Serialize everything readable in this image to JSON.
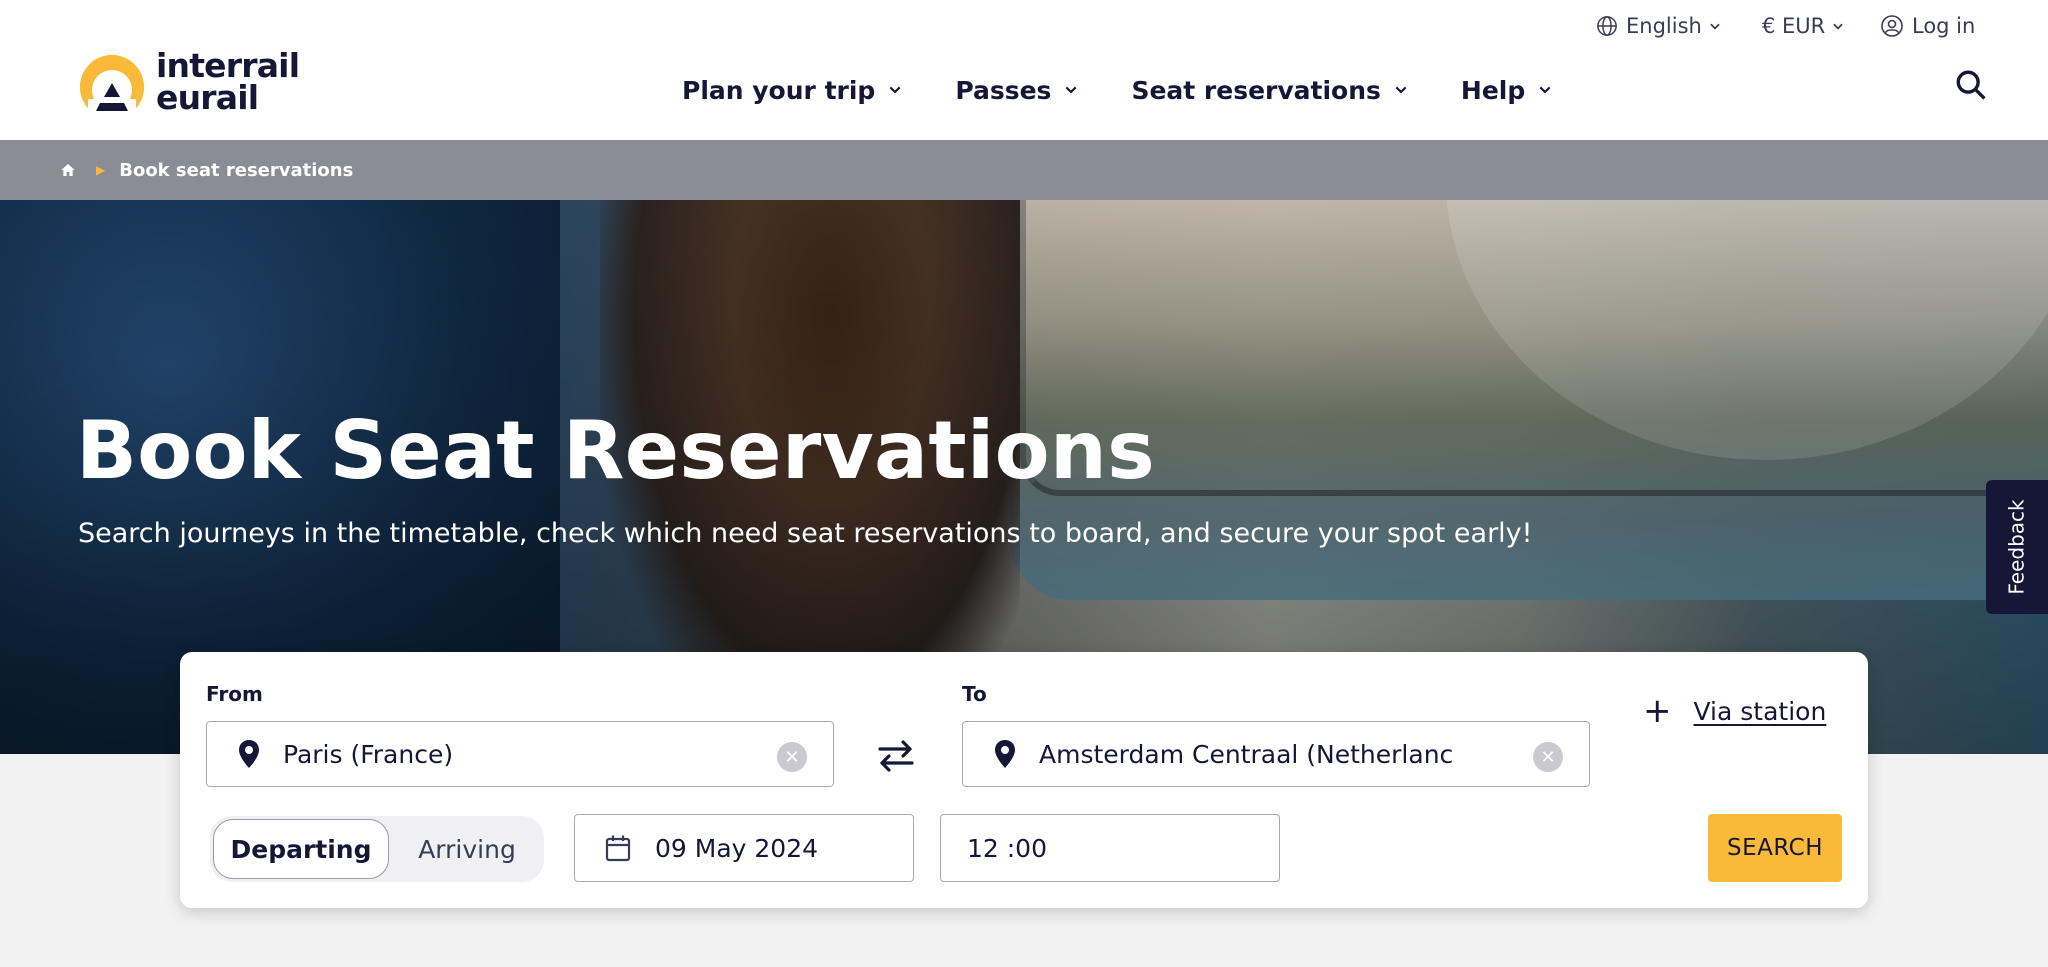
{
  "header": {
    "brand": {
      "line1": "interrail",
      "line2": "eurail"
    },
    "utility": {
      "language": "English",
      "currency": "€ EUR",
      "login": "Log in"
    },
    "nav": [
      {
        "label": "Plan your trip"
      },
      {
        "label": "Passes"
      },
      {
        "label": "Seat reservations"
      },
      {
        "label": "Help"
      }
    ]
  },
  "breadcrumb": {
    "current": "Book seat reservations"
  },
  "hero": {
    "title": "Book Seat Reservations",
    "subtitle": "Search journeys in the timetable, check which need seat reservations to board, and secure your spot early!"
  },
  "feedback": {
    "label": "Feedback"
  },
  "search": {
    "from_label": "From",
    "from_value": "Paris (France)",
    "to_label": "To",
    "to_value": "Amsterdam Centraal (Netherlanc",
    "via_label": "Via station",
    "mode_departing": "Departing",
    "mode_arriving": "Arriving",
    "selected_mode": "Departing",
    "date": "09 May 2024",
    "time": "12 :00",
    "submit_label": "SEARCH"
  },
  "colors": {
    "brand_yellow": "#fbb93a",
    "navy": "#161737",
    "breadcrumb_bg": "#8c8d94"
  }
}
